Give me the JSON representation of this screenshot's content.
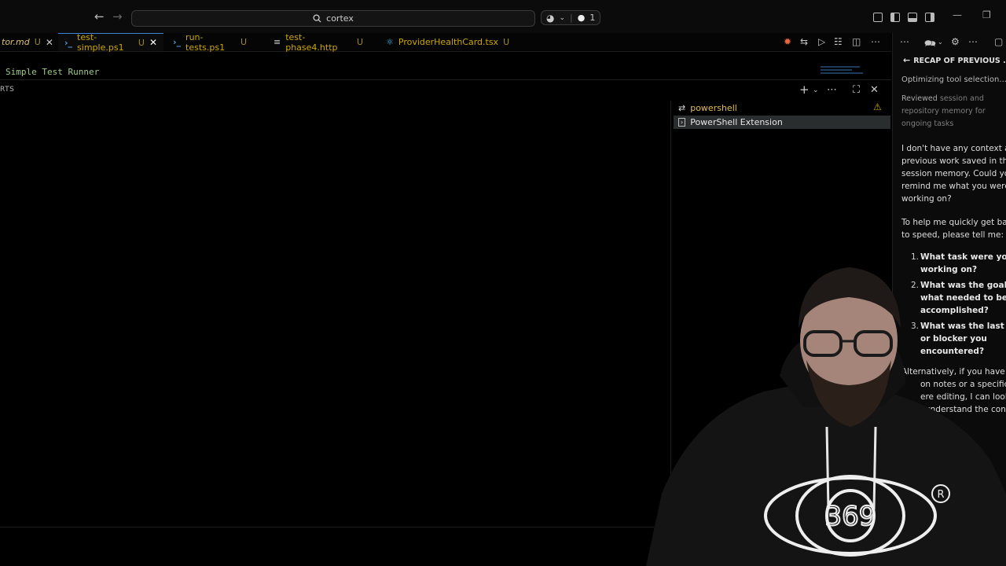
{
  "titlebar": {
    "back_icon": "arrow-left-icon",
    "forward_icon": "arrow-right-icon",
    "search_text": "cortex",
    "copilot_count": "1"
  },
  "tabs": [
    {
      "label": "tor.md",
      "modified": "U",
      "icon": "markdown-icon"
    },
    {
      "label": "test-simple.ps1",
      "modified": "U",
      "icon": "powershell-icon"
    },
    {
      "label": "run-tests.ps1",
      "modified": "U",
      "icon": "powershell-icon"
    },
    {
      "label": "test-phase4.http",
      "modified": "U",
      "icon": "http-file-icon"
    },
    {
      "label": "ProviderHealthCard.tsx",
      "modified": "U",
      "icon": "react-icon"
    }
  ],
  "editor": {
    "line_text": "Simple Test Runner"
  },
  "panel": {
    "tab_label": "RTS",
    "terminals": [
      {
        "label": "powershell",
        "icon": "terminal-icon"
      },
      {
        "label": "PowerShell Extension",
        "icon": "terminal-icon"
      }
    ]
  },
  "chat": {
    "title": "RECAP OF PREVIOUS ...",
    "status": "Optimizing tool selection...",
    "reviewed_prefix": "Reviewed",
    "reviewed_rest": "session and repository memory for ongoing tasks",
    "para1": [
      "I don't have any context ab",
      "previous work saved in the",
      "session memory. Could you",
      "remind me what you were",
      "working on?"
    ],
    "para2": [
      "To help me quickly get back",
      "to speed, please tell me:"
    ],
    "list": [
      {
        "num": "1.",
        "lines": [
          "What task were you",
          "working on?"
        ]
      },
      {
        "num": "2.",
        "lines": [
          "What was the goal or",
          "what needed to be",
          "accomplished?"
        ]
      },
      {
        "num": "3.",
        "lines": [
          "What was the last stat",
          "or blocker you",
          "encountered?"
        ]
      }
    ],
    "para3": [
      "Alternatively, if you have",
      "on notes or a specific f",
      "ere editing, I can look",
      "understand the cont"
    ]
  },
  "webcam": {
    "logo_text": "369"
  }
}
